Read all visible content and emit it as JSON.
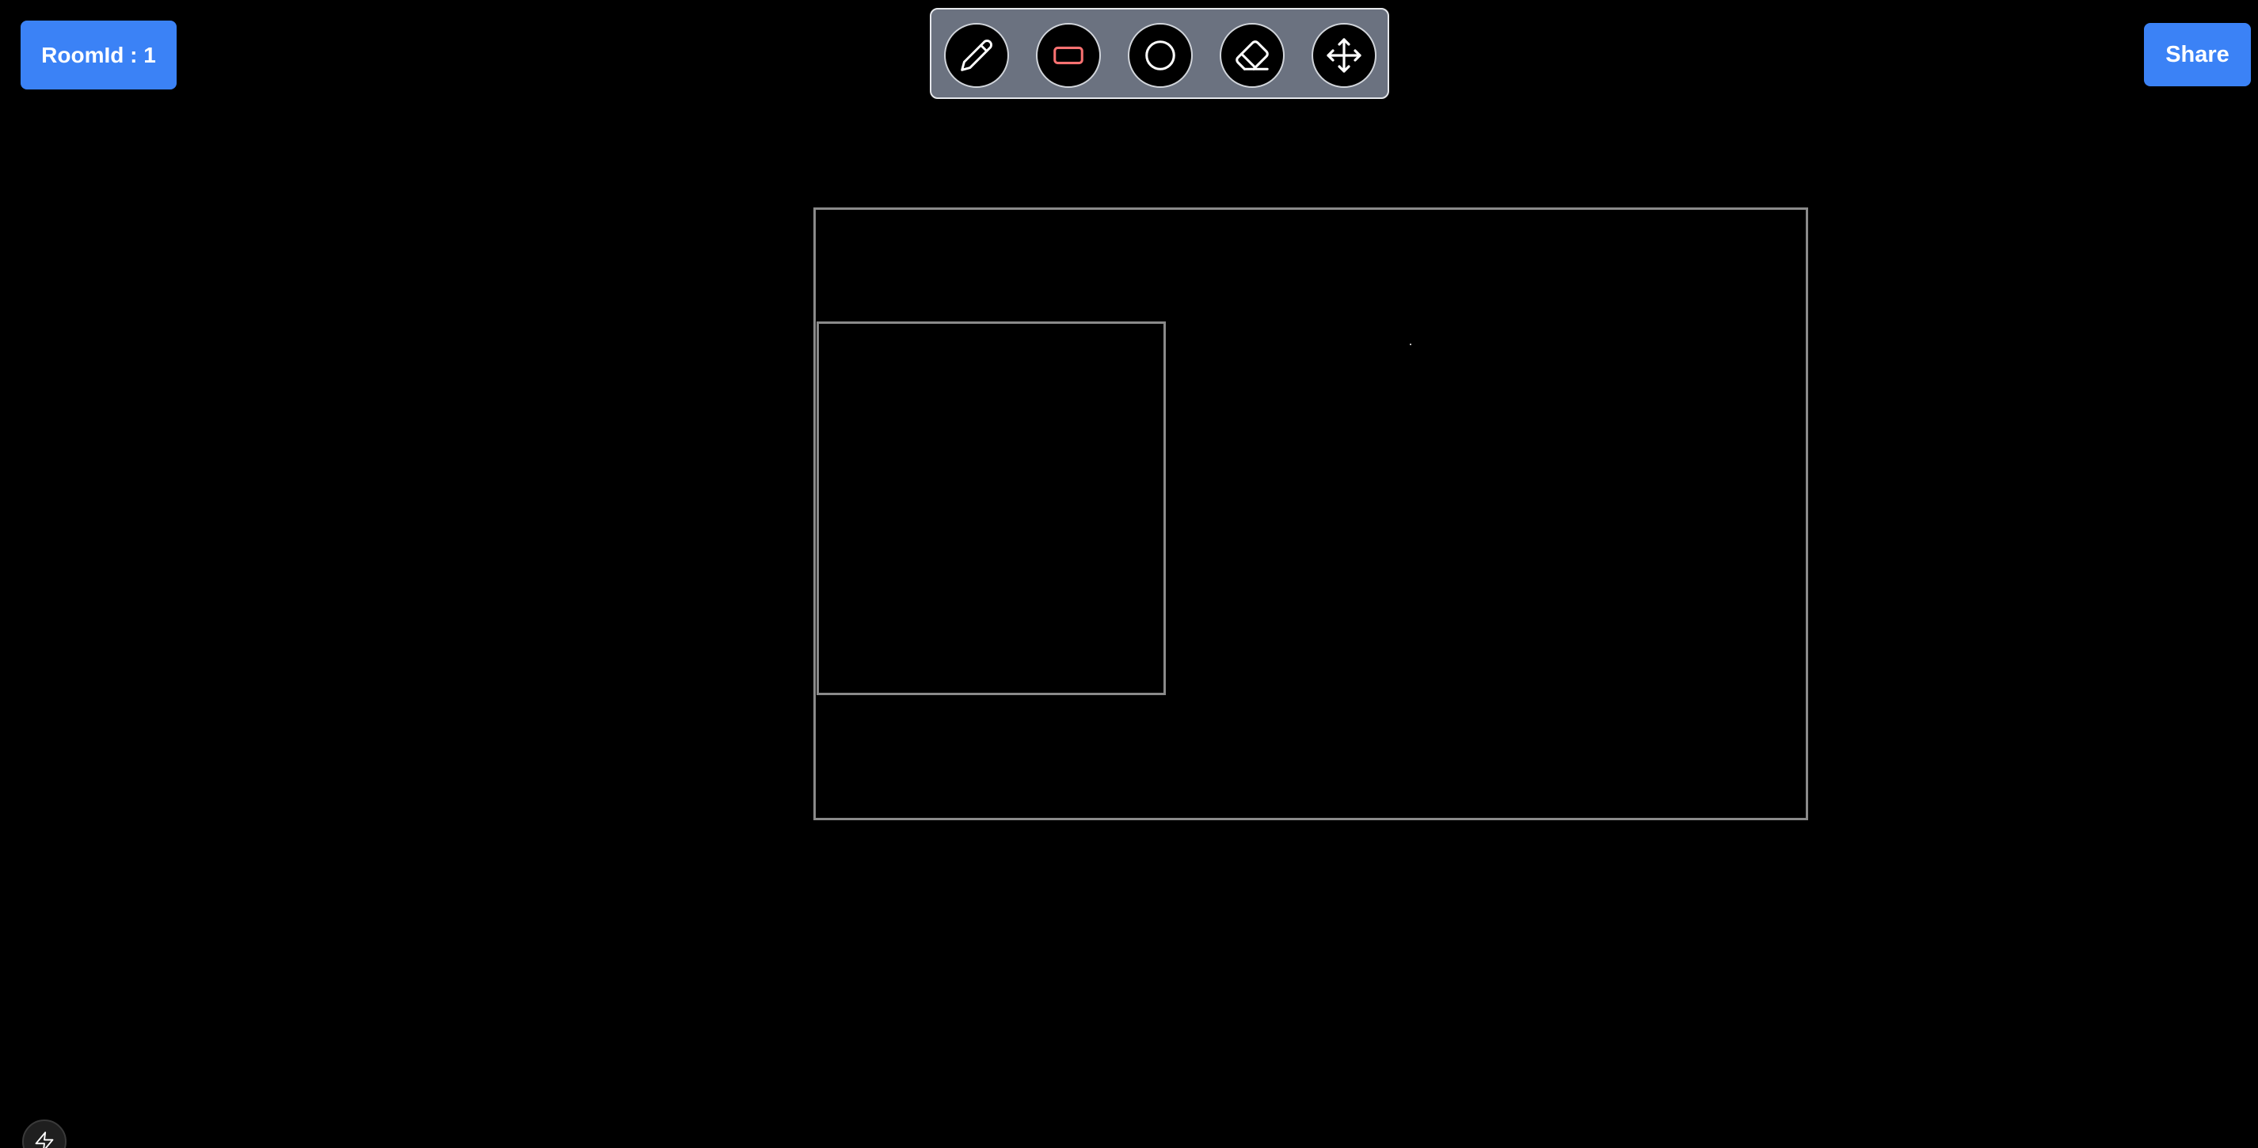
{
  "header": {
    "room_label": "RoomId : 1",
    "share_label": "Share"
  },
  "toolbar": {
    "tools": [
      {
        "name": "pencil",
        "icon": "pencil-icon",
        "selected": false
      },
      {
        "name": "rectangle",
        "icon": "rectangle-icon",
        "selected": true
      },
      {
        "name": "circle",
        "icon": "circle-icon",
        "selected": false
      },
      {
        "name": "eraser",
        "icon": "eraser-icon",
        "selected": false
      },
      {
        "name": "move",
        "icon": "move-icon",
        "selected": false
      }
    ]
  },
  "canvas": {
    "shapes": [
      "rectangle",
      "rectangle",
      "dot"
    ]
  },
  "colors": {
    "background": "#000000",
    "accent": "#3b82f6",
    "toolbar": "#6b7280",
    "selected_tool": "#f87171",
    "shape_stroke": "#8a8a8a"
  },
  "badge": {
    "icon": "lightning-icon"
  }
}
